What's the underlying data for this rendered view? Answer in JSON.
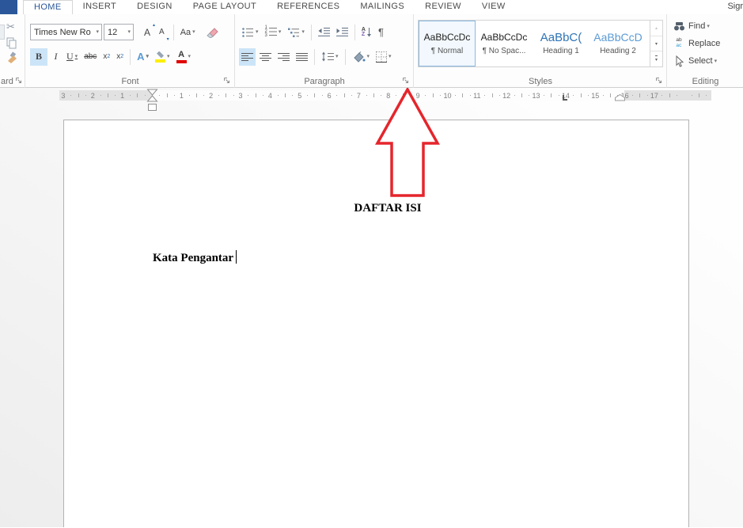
{
  "window": {
    "signin_label": "Sigr"
  },
  "tabs": {
    "active": "HOME",
    "items": [
      "HOME",
      "INSERT",
      "DESIGN",
      "PAGE LAYOUT",
      "REFERENCES",
      "MAILINGS",
      "REVIEW",
      "VIEW"
    ]
  },
  "ribbon": {
    "clipboard": {
      "label": "ard",
      "scissors_glyph": "✂"
    },
    "font": {
      "label": "Font",
      "font_name": "Times New Ro",
      "font_size": "12",
      "grow_letter": "A",
      "shrink_letter": "A",
      "change_case": "Aa",
      "bold": "B",
      "italic": "I",
      "underline": "U",
      "strikethrough": "abc",
      "sub_base": "x",
      "sub_num": "2",
      "sup_base": "x",
      "sup_num": "2",
      "effects_letter": "A",
      "font_color_letter": "A"
    },
    "paragraph": {
      "label": "Paragraph",
      "numbering_digits": [
        "1",
        "2",
        "3"
      ],
      "sort_a": "A",
      "sort_z": "Z",
      "pilcrow": "¶"
    },
    "styles": {
      "label": "Styles",
      "items": [
        {
          "sample": "AaBbCcDc",
          "name": "¶ Normal"
        },
        {
          "sample": "AaBbCcDc",
          "name": "¶ No Spac..."
        },
        {
          "sample": "AaBbC(",
          "name": "Heading 1"
        },
        {
          "sample": "AaBbCcD",
          "name": "Heading 2"
        }
      ]
    },
    "editing": {
      "label": "Editing",
      "find": "Find",
      "replace": "Replace",
      "select": "Select",
      "replace_icon_top": "ab",
      "replace_icon_bottom": "ac"
    }
  },
  "ruler": {
    "left_numbers": [
      3,
      2,
      1
    ],
    "right_numbers": [
      1,
      2,
      3,
      4,
      5,
      6,
      7,
      8,
      9,
      10,
      11,
      12,
      13,
      14,
      15,
      16,
      17
    ]
  },
  "document": {
    "heading": "DAFTAR ISI",
    "line": "Kata Pengantar"
  },
  "icons": {
    "caret": "▾",
    "up": "▴",
    "down": "▾"
  },
  "colors": {
    "accent_blue": "#2b579a",
    "heading1_blue": "#2e74b5",
    "heading2_blue": "#5b9bd5",
    "selection_blue": "#cce4f7",
    "arrow_red": "#e5252c",
    "highlight_yellow": "#fdef00",
    "font_color_red": "#e00000"
  }
}
